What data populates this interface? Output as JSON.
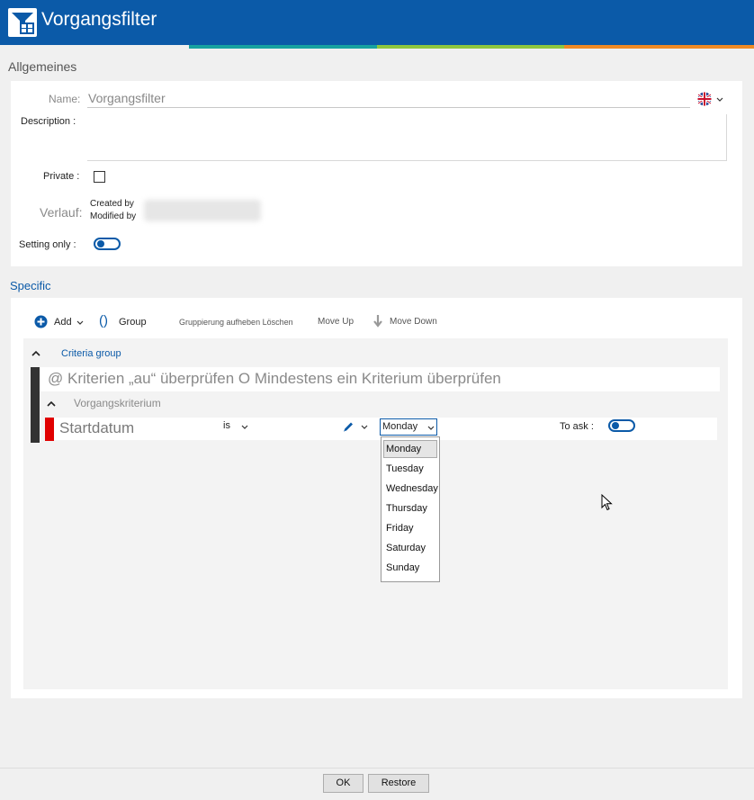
{
  "window": {
    "title": "Vorgangsfilter",
    "icon": "filter-table-icon"
  },
  "general": {
    "section_title": "Allgemeines",
    "name_label": "Name:",
    "name_value": "Vorgangsfilter",
    "description_label": "Description :",
    "description_value": "",
    "private_label": "Private :",
    "history_label": "Verlauf:",
    "created_by": "Created by",
    "modified_by": "Modified by",
    "setting_only_label": "Setting only :"
  },
  "specific": {
    "section_title": "Specific",
    "toolbar": {
      "add": "Add",
      "group": "Group",
      "ungroup_delete": "Gruppierung aufheben Löschen",
      "move_up": "Move Up",
      "move_down": "Move Down"
    },
    "criteria_group_label": "Criteria group",
    "criteria_check_text": "@ Kriterien „au“ überprüfen O Mindestens ein Kriterium überprüfen",
    "criterion_label": "Vorgangskriterium",
    "criterion": {
      "field": "Startdatum",
      "operator": "is",
      "value": "Monday",
      "to_ask_label": "To ask :"
    },
    "day_options": [
      "Monday",
      "Tuesday",
      "Wednesday",
      "Thursday",
      "Friday",
      "Saturday",
      "Sunday"
    ]
  },
  "footer": {
    "ok": "OK",
    "restore": "Restore"
  },
  "colors": {
    "accent": "#0b5aa8",
    "required": "#e00000",
    "stripe_teal": "#17a2a0",
    "stripe_green": "#8dc63f",
    "stripe_orange": "#f08a24"
  }
}
